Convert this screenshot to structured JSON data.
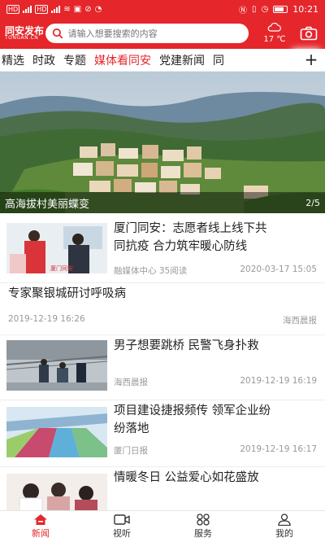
{
  "status_bar": {
    "time": "10:21",
    "net_label_1": "HD",
    "net_label_2": "HD"
  },
  "header": {
    "logo_text": "同安发布",
    "logo_sub": "TONGAN.CN",
    "search_placeholder": "请输入想要搜索的内容",
    "temperature": "17 ℃"
  },
  "tabs": [
    "精选",
    "时政",
    "专题",
    "媒体看同安",
    "党建新闻",
    "同"
  ],
  "active_tab": 3,
  "banner": {
    "caption": "高海拔村美丽蝶变",
    "pager": "2/5"
  },
  "news": [
    {
      "title_line1": "厦门同安：志愿者线上线下共",
      "title_line2": "同抗疫 合力筑牢暖心防线",
      "source": "融媒体中心 35阅读",
      "date": "2020-03-17 15:05"
    },
    {
      "title": "专家聚银城研讨呼吸病",
      "date": "2019-12-19 16:26",
      "source": "海西晨报"
    },
    {
      "title": "男子想要跳桥 民警飞身扑救",
      "source": "海西晨报",
      "date": "2019-12-19 16:19"
    },
    {
      "title_line1": "项目建设捷报频传 领军企业纷",
      "title_line2": "纷落地",
      "source": "厦门日报",
      "date": "2019-12-19 16:17"
    },
    {
      "title": "情暖冬日 公益爱心如花盛放"
    }
  ],
  "bottom_nav": [
    "新闻",
    "视听",
    "服务",
    "我的"
  ],
  "colors": {
    "brand_red": "#e5262b",
    "meta_gray": "#999999"
  }
}
